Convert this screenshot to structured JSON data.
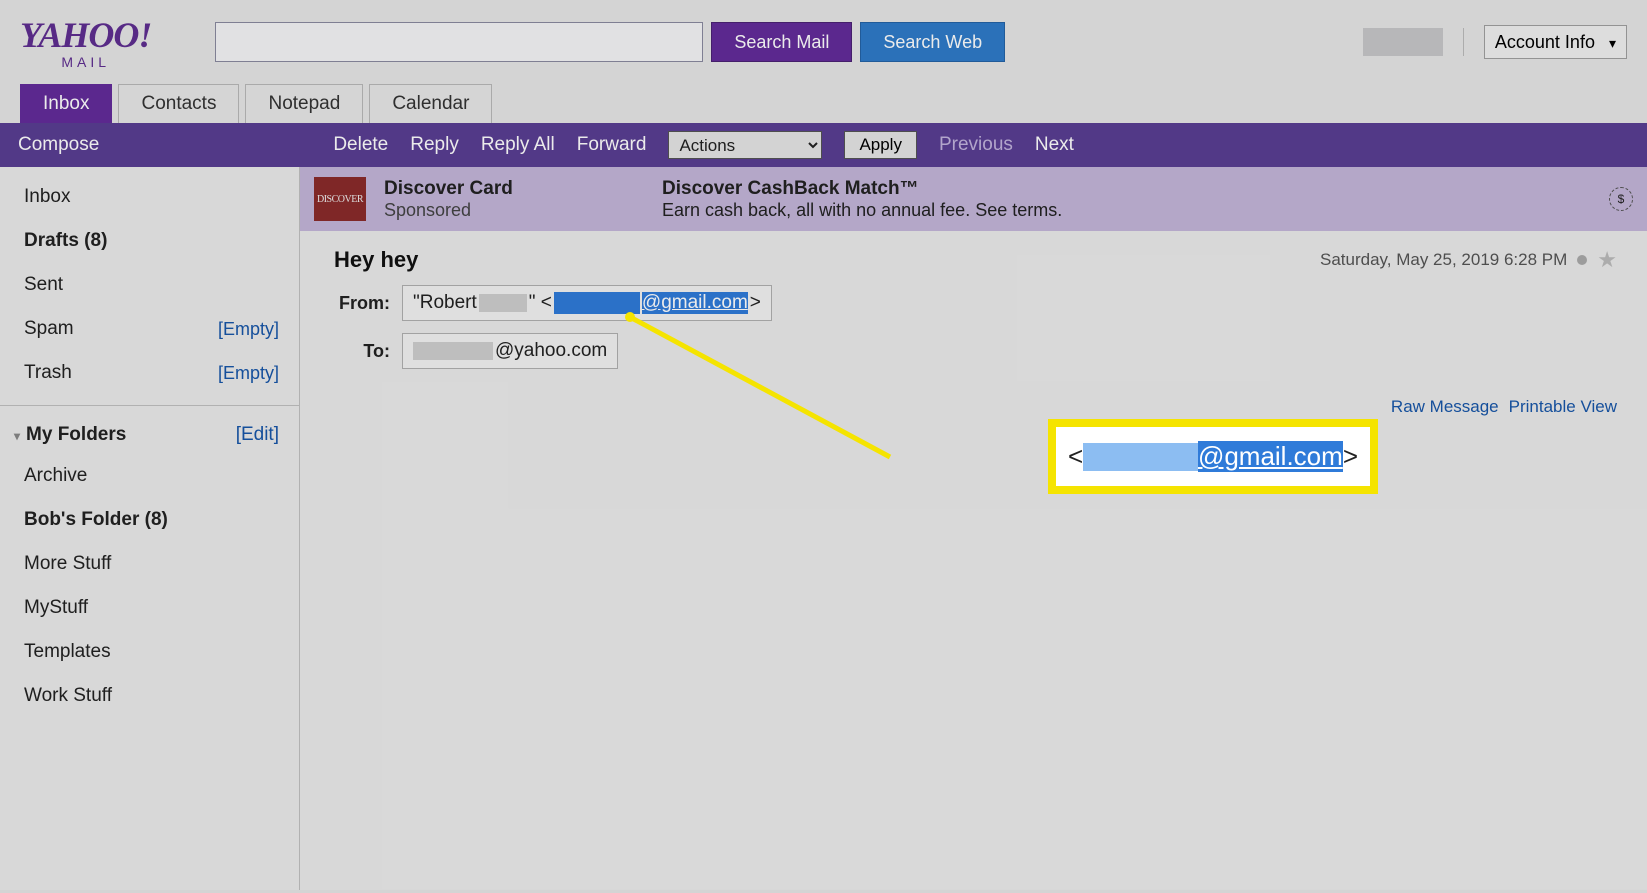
{
  "logo": {
    "top": "YAHOO!",
    "bottom": "MAIL"
  },
  "search": {
    "value": "",
    "btn_mail": "Search Mail",
    "btn_web": "Search Web"
  },
  "header": {
    "account_info": "Account Info"
  },
  "tabs": [
    {
      "label": "Inbox",
      "active": true
    },
    {
      "label": "Contacts",
      "active": false
    },
    {
      "label": "Notepad",
      "active": false
    },
    {
      "label": "Calendar",
      "active": false
    }
  ],
  "toolbar": {
    "compose": "Compose",
    "delete": "Delete",
    "reply": "Reply",
    "reply_all": "Reply All",
    "forward": "Forward",
    "actions_label": "Actions",
    "apply": "Apply",
    "previous": "Previous",
    "next": "Next"
  },
  "sidebar": {
    "items": [
      {
        "name": "Inbox",
        "count": "",
        "bold": false,
        "empty": false
      },
      {
        "name": "Drafts",
        "count": "(8)",
        "bold": true,
        "empty": false
      },
      {
        "name": "Sent",
        "count": "",
        "bold": false,
        "empty": false
      },
      {
        "name": "Spam",
        "count": "",
        "bold": false,
        "empty": true
      },
      {
        "name": "Trash",
        "count": "",
        "bold": false,
        "empty": true
      }
    ],
    "empty_label": "[Empty]",
    "section_title": "My Folders",
    "edit_label": "[Edit]",
    "folders": [
      {
        "name": "Archive",
        "count": "",
        "bold": false
      },
      {
        "name": "Bob's Folder",
        "count": "(8)",
        "bold": true
      },
      {
        "name": "More Stuff",
        "count": "",
        "bold": false
      },
      {
        "name": "MyStuff",
        "count": "",
        "bold": false
      },
      {
        "name": "Templates",
        "count": "",
        "bold": false
      },
      {
        "name": "Work Stuff",
        "count": "",
        "bold": false
      }
    ]
  },
  "sponsored": {
    "badge": "DISCOVER",
    "title": "Discover Card",
    "sub": "Sponsored",
    "headline": "Discover CashBack Match™",
    "desc": "Earn cash back, all with no annual fee. See terms.",
    "icon": "$"
  },
  "message": {
    "subject": "Hey hey",
    "date": "Saturday, May 25, 2019 6:28 PM",
    "from_label": "From:",
    "to_label": "To:",
    "from_name_prefix": "\"Robert ",
    "from_name_suffix": "\" <",
    "from_email_domain": "@gmail.com",
    "from_close": ">",
    "to_domain": "@yahoo.com",
    "raw_link": "Raw Message",
    "print_link": "Printable View"
  },
  "callout": {
    "open": "<",
    "domain": "@gmail.com",
    "close": ">"
  }
}
